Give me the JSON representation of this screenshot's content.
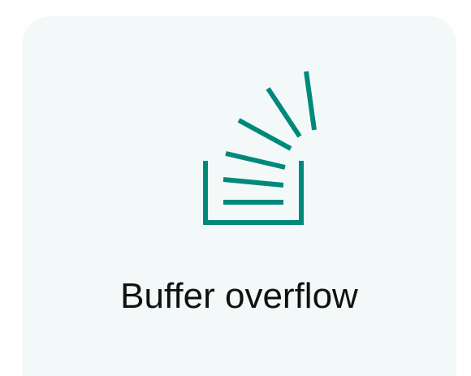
{
  "card": {
    "title": "Buffer overflow",
    "icon": "stack-overflow-icon",
    "background": "#f3f9f9",
    "accent": "#00897b"
  }
}
